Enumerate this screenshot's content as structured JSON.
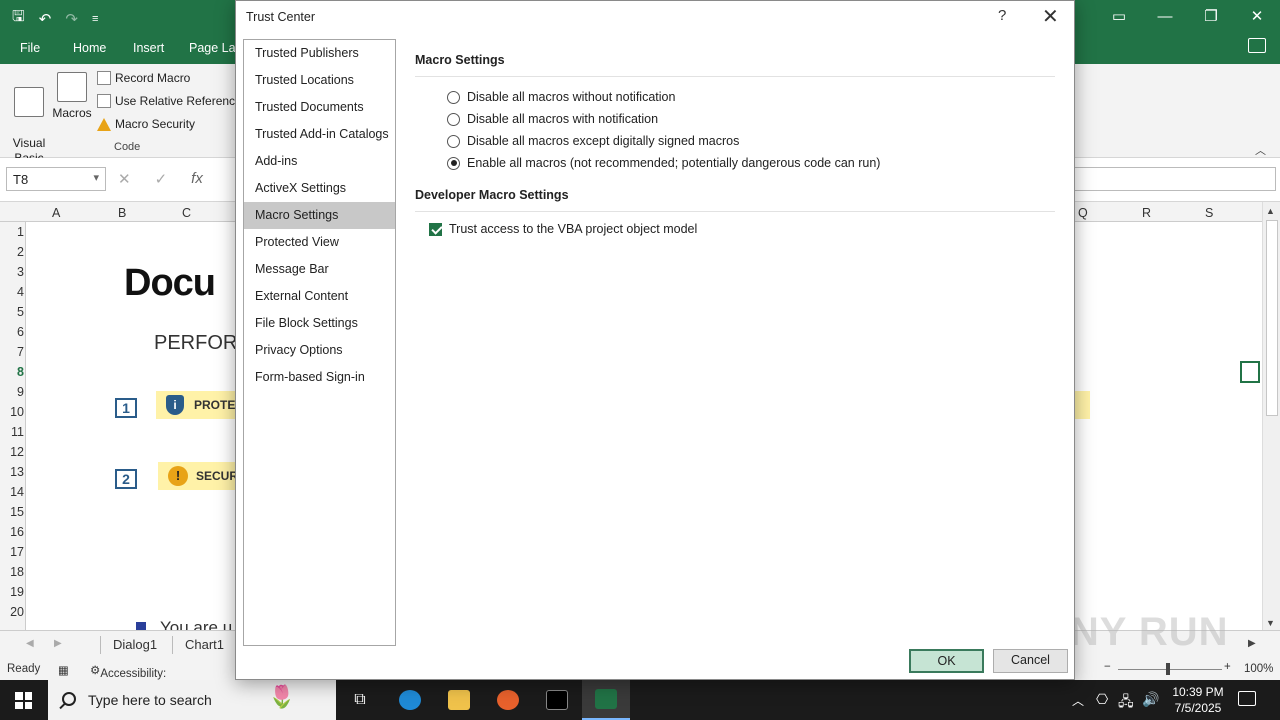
{
  "excel": {
    "tabs": [
      "File",
      "Home",
      "Insert",
      "Page Lay"
    ],
    "ribbon": {
      "visual_basic": "Visual\nBasic",
      "macros": "Macros",
      "record_macro": "Record Macro",
      "use_relative": "Use Relative References",
      "macro_security": "Macro Security",
      "group_label": "Code"
    },
    "name_box": "T8",
    "fx": "fx",
    "columns": [
      "A",
      "B",
      "C",
      "Q",
      "R",
      "S"
    ],
    "rows": [
      "1",
      "2",
      "3",
      "4",
      "5",
      "6",
      "7",
      "8",
      "9",
      "10",
      "11",
      "12",
      "13",
      "14",
      "15",
      "16",
      "17",
      "18",
      "19",
      "20"
    ],
    "sheet": {
      "logo": "Docu",
      "heading": "PERFOR",
      "step1": "1",
      "step1_text": "PROTEC",
      "step2": "2",
      "step2_text": "SECUR",
      "bullet_text": "You are u"
    },
    "sheet_tabs": [
      "Dialog1",
      "Chart1"
    ],
    "status": {
      "ready": "Ready",
      "accessibility": "Accessibility: Unavailable",
      "zoom": "100%"
    }
  },
  "dialog": {
    "title": "Trust Center",
    "help": "?",
    "close": "✕",
    "nav": [
      {
        "label": "Trusted Publishers",
        "selected": false
      },
      {
        "label": "Trusted Locations",
        "selected": false
      },
      {
        "label": "Trusted Documents",
        "selected": false
      },
      {
        "label": "Trusted Add-in Catalogs",
        "selected": false
      },
      {
        "label": "Add-ins",
        "selected": false
      },
      {
        "label": "ActiveX Settings",
        "selected": false
      },
      {
        "label": "Macro Settings",
        "selected": true
      },
      {
        "label": "Protected View",
        "selected": false
      },
      {
        "label": "Message Bar",
        "selected": false
      },
      {
        "label": "External Content",
        "selected": false
      },
      {
        "label": "File Block Settings",
        "selected": false
      },
      {
        "label": "Privacy Options",
        "selected": false
      },
      {
        "label": "Form-based Sign-in",
        "selected": false
      }
    ],
    "macro_settings": {
      "title": "Macro Settings",
      "options": [
        {
          "label": "Disable all macros without notification",
          "checked": false
        },
        {
          "label": "Disable all macros with notification",
          "checked": false
        },
        {
          "label": "Disable all macros except digitally signed macros",
          "checked": false
        },
        {
          "label": "Enable all macros (not recommended; potentially dangerous code can run)",
          "checked": true
        }
      ]
    },
    "developer_settings": {
      "title": "Developer Macro Settings",
      "trust_vba": {
        "label": "Trust access to the VBA project object model",
        "checked": true
      }
    },
    "ok_label": "OK",
    "cancel_label": "Cancel"
  },
  "taskbar": {
    "search_placeholder": "Type here to search",
    "time": "10:39 PM",
    "date": "7/5/2025"
  },
  "watermark": "ANY RUN",
  "colors": {
    "excel_green": "#217346",
    "selected_nav": "#c8c8c8",
    "ok_button": "#c6e4d4"
  }
}
